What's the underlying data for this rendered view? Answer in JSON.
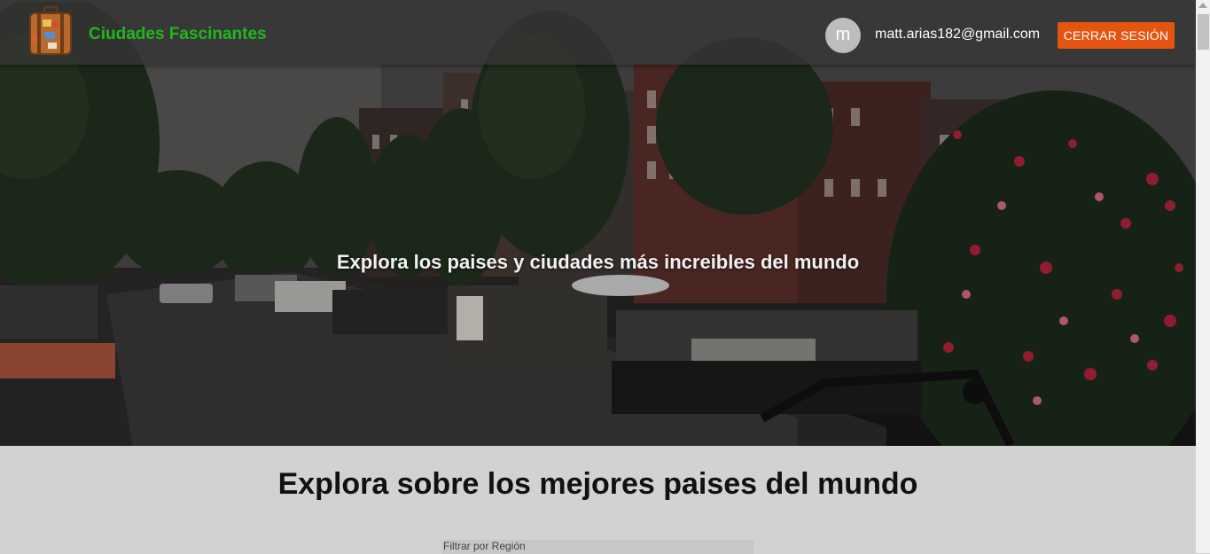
{
  "navbar": {
    "brand": "Ciudades Fascinantes",
    "logo_icon": "suitcase-icon",
    "avatar_letter": "m",
    "user_email": "matt.arias182@gmail.com",
    "logout_label": "CERRAR SESIÓN"
  },
  "hero": {
    "title": "Explora los paises y ciudades más increibles del mundo"
  },
  "section": {
    "title": "Explora sobre los mejores paises del mundo",
    "filter_label": "Filtrar por Región"
  },
  "colors": {
    "brand": "#1fb81c",
    "logout_button": "#e6550f",
    "navbar": "#373737",
    "page_background": "#d3d1d1"
  }
}
